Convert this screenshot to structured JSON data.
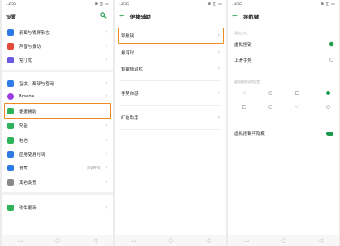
{
  "status": {
    "time": "13:55",
    "right": "⊗ ◫ ▭"
  },
  "screen1": {
    "title": "设置",
    "items": [
      {
        "label": "桌面与锁屏杂志",
        "color": "#2f7be5"
      },
      {
        "label": "声音与振动",
        "color": "#e5493a"
      },
      {
        "label": "免打扰",
        "color": "#6a5be0"
      },
      {
        "label": "指纹、面部与密码",
        "color": "#2f7be5"
      },
      {
        "label": "Breeno",
        "color": "#9b3be0"
      },
      {
        "label": "便捷辅助",
        "color": "#2eb35a"
      },
      {
        "label": "安全",
        "color": "#2eb35a"
      },
      {
        "label": "电池",
        "color": "#2eb35a"
      },
      {
        "label": "应用使用时间",
        "color": "#2f7be5"
      },
      {
        "label": "语言",
        "color": "#2f7be5",
        "extra": "简体中文"
      },
      {
        "label": "其他设置",
        "color": "#8a8a8a"
      },
      {
        "label": "软件更新",
        "color": "#2eb35a"
      }
    ]
  },
  "screen2": {
    "title": "便捷辅助",
    "items": [
      "导航键",
      "悬浮球",
      "智能侧边栏",
      "手势体感",
      "红包助手"
    ]
  },
  "screen3": {
    "title": "导航键",
    "section1": "导航方式",
    "options": [
      "虚拟按键",
      "上滑手势"
    ],
    "section2": "虚拟按键导航位置",
    "hide_label": "虚拟按键可隐藏"
  },
  "icons": {
    "back": "←",
    "chevron": "›",
    "search": "search-icon"
  },
  "colors": {
    "accent": "#1a9a4a",
    "highlight": "#f08a1e"
  }
}
